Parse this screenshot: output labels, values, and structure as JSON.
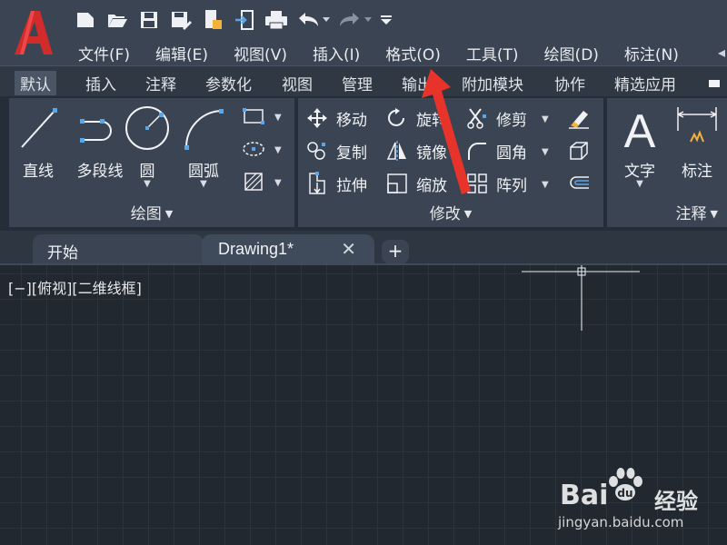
{
  "menubar": {
    "items": [
      "文件(F)",
      "编辑(E)",
      "视图(V)",
      "插入(I)",
      "格式(O)",
      "工具(T)",
      "绘图(D)",
      "标注(N)"
    ],
    "overflow": "◂"
  },
  "quick_access": {
    "icons": [
      "new-file-icon",
      "open-icon",
      "save-icon",
      "save-as-icon",
      "open-from-cloud-icon",
      "share-icon",
      "print-icon",
      "undo-icon",
      "redo-icon",
      "customize-icon"
    ]
  },
  "ribbon_tabs": [
    "默认",
    "插入",
    "注释",
    "参数化",
    "视图",
    "管理",
    "输出",
    "附加模块",
    "协作",
    "精选应用"
  ],
  "ribbon": {
    "draw_panel": {
      "title": "绘图",
      "tools": {
        "line": "直线",
        "polyline": "多段线",
        "circle": "圆",
        "arc": "圆弧"
      }
    },
    "modify_panel": {
      "title": "修改",
      "tools": {
        "move": "移动",
        "rotate": "旋转",
        "trim": "修剪",
        "copy": "复制",
        "mirror": "镜像",
        "fillet": "圆角",
        "stretch": "拉伸",
        "scale": "缩放",
        "array": "阵列"
      }
    },
    "annotation_panel": {
      "title": "注释",
      "tools": {
        "text": "文字",
        "dimension": "标注"
      }
    }
  },
  "file_tabs": {
    "start": "开始",
    "drawing": "Drawing1*",
    "close": "✕",
    "new": "+"
  },
  "viewport": {
    "label": "[−][俯视][二维线框]"
  },
  "watermark": {
    "brand": "Bai",
    "brand2": "经验",
    "url": "jingyan.baidu.com"
  },
  "colors": {
    "logo": "#d12b2b",
    "arrow": "#e8332a",
    "ribbon_icon_blue": "#5aa6e8",
    "panel_bg": "#3b4453",
    "canvas_bg": "#212830"
  }
}
